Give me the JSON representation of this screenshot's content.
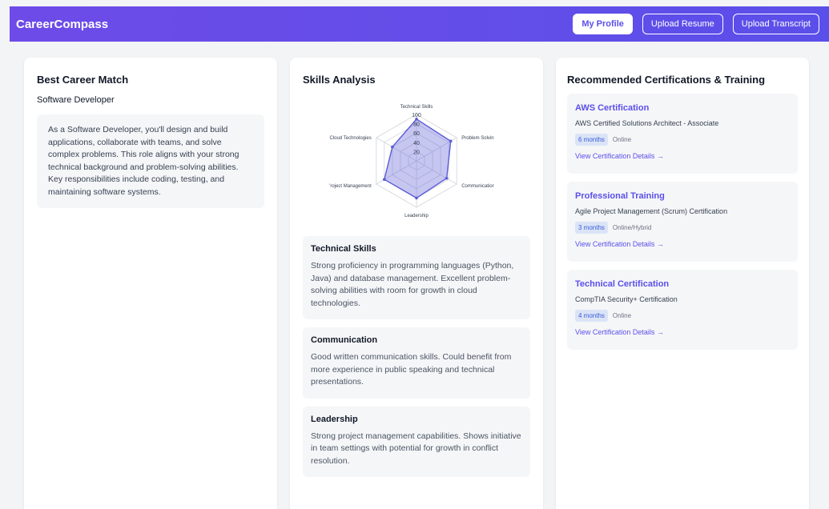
{
  "header": {
    "logo": "CareerCompass",
    "my_profile": "My Profile",
    "upload_resume": "Upload Resume",
    "upload_transcript": "Upload Transcript"
  },
  "career": {
    "title": "Best Career Match",
    "name": "Software Developer",
    "description": "As a Software Developer, you'll design and build applications, collaborate with teams, and solve complex problems. This role aligns with your strong technical background and problem-solving abilities. Key responsibilities include coding, testing, and maintaining software systems."
  },
  "skills": {
    "title": "Skills Analysis",
    "radar": {
      "ticks": [
        "20",
        "40",
        "60",
        "80",
        "100"
      ],
      "axes": [
        {
          "label": "Technical Skills",
          "value": 90
        },
        {
          "label": "Problem Solvin",
          "value": 85
        },
        {
          "label": "Communicatior",
          "value": 75
        },
        {
          "label": "Leadership",
          "value": 80
        },
        {
          "label": "'roject Management",
          "value": 80
        },
        {
          "label": "Cloud Technologies",
          "value": 60
        }
      ],
      "fill_color": "#5b5bd6",
      "grid_color": "#d1d5db"
    },
    "items": [
      {
        "title": "Technical Skills",
        "desc": "Strong proficiency in programming languages (Python, Java) and database management. Excellent problem-solving abilities with room for growth in cloud technologies."
      },
      {
        "title": "Communication",
        "desc": "Good written communication skills. Could benefit from more experience in public speaking and technical presentations."
      },
      {
        "title": "Leadership",
        "desc": "Strong project management capabilities. Shows initiative in team settings with potential for growth in conflict resolution."
      }
    ]
  },
  "certs": {
    "title": "Recommended Certifications & Training",
    "items": [
      {
        "title": "AWS Certification",
        "sub": "AWS Certified Solutions Architect - Associate",
        "duration": "6 months",
        "mode": "Online",
        "link": "View Certification Details →"
      },
      {
        "title": "Professional Training",
        "sub": "Agile Project Management (Scrum) Certification",
        "duration": "3 months",
        "mode": "Online/Hybrid",
        "link": "View Certification Details →"
      },
      {
        "title": "Technical Certification",
        "sub": "CompTIA Security+ Certification",
        "duration": "4 months",
        "mode": "Online",
        "link": "View Certification Details →"
      }
    ]
  }
}
